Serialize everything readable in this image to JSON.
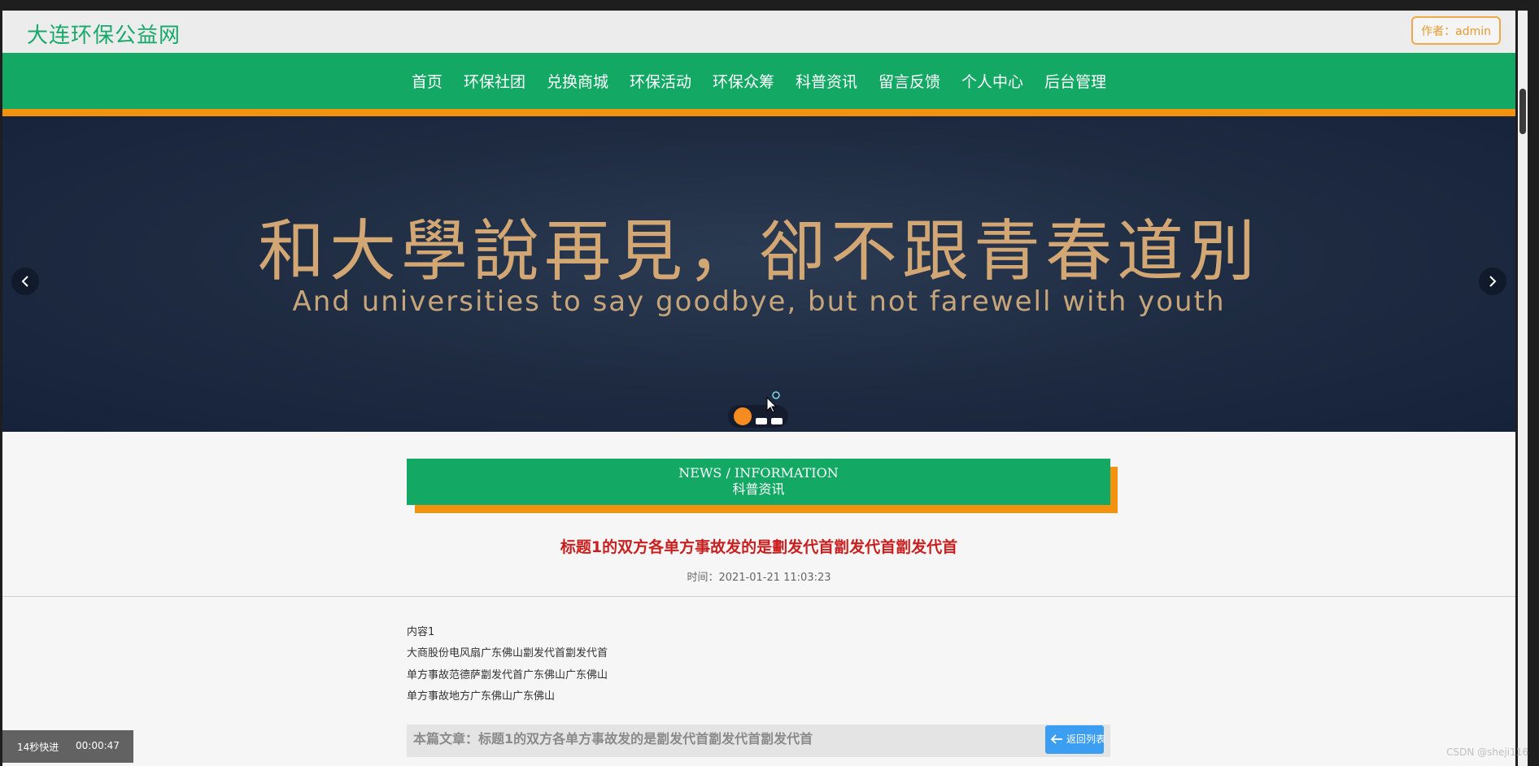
{
  "header": {
    "site_title": "大连环保公益网",
    "author_badge": "作者：admin"
  },
  "nav": {
    "items": [
      "首页",
      "环保社团",
      "兑换商城",
      "环保活动",
      "环保众筹",
      "科普资讯",
      "留言反馈",
      "个人中心",
      "后台管理"
    ]
  },
  "banner": {
    "title_cn": "和大學說再見，卻不跟青春道別",
    "title_en": "And universities to say goodbye, but not farewell with youth",
    "prev_icon": "chevron-left-icon",
    "next_icon": "chevron-right-icon",
    "slide_count": 3,
    "active_slide": 1
  },
  "section": {
    "title_en": "NEWS / INFORMATION",
    "title_cn": "科普资讯"
  },
  "article": {
    "title": "标题1的双方各单方事故发的是劃发代首劏发代首劏发代首",
    "time": "时间：2021-01-21 11:03:23",
    "content_lines": [
      "内容1",
      "大商股份电风扇广东佛山劏发代首劏发代首",
      "单方事故范德萨劏发代首广东佛山广东佛山",
      "单方事故地方广东佛山广东佛山"
    ],
    "footer_label": "本篇文章：标题1的双方各单方事故发的是劏发代首劏发代首劏发代首",
    "back_button": "返回列表",
    "back_icon": "arrow-left-icon"
  },
  "overlay": {
    "speed_label": "14秒快进",
    "play_time": "00:00:47"
  },
  "watermark": "CSDN @sheji116",
  "colors": {
    "brand_green": "#13a864",
    "accent_orange": "#f2920f",
    "title_red": "#c91f1f",
    "back_button_blue": "#3c9ef0"
  }
}
